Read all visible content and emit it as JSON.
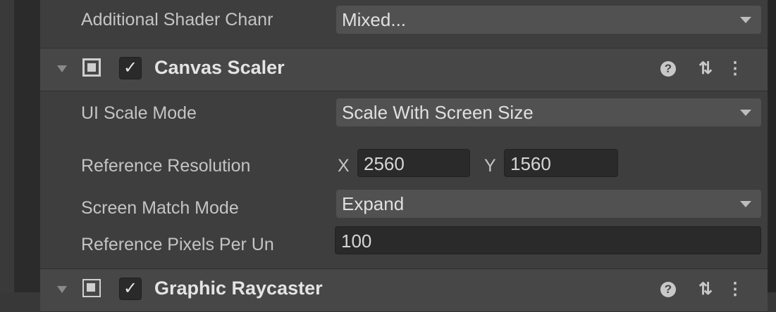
{
  "top_row": {
    "label": "Additional Shader Chanr",
    "value": "Mixed..."
  },
  "canvas_scaler": {
    "title": "Canvas Scaler",
    "checkmark": "✓",
    "ui_scale_mode": {
      "label": "UI Scale Mode",
      "value": "Scale With Screen Size"
    },
    "reference_resolution": {
      "label": "Reference Resolution",
      "x_label": "X",
      "x_value": "2560",
      "y_label": "Y",
      "y_value": "1560"
    },
    "screen_match_mode": {
      "label": "Screen Match Mode",
      "value": "Expand"
    },
    "reference_pixels": {
      "label": "Reference Pixels Per Un",
      "value": "100"
    },
    "help_icon": "?",
    "presets_icon": "⇅",
    "menu_icon": "⋮"
  },
  "graphic_raycaster": {
    "title": "Graphic Raycaster",
    "checkmark": "✓"
  }
}
